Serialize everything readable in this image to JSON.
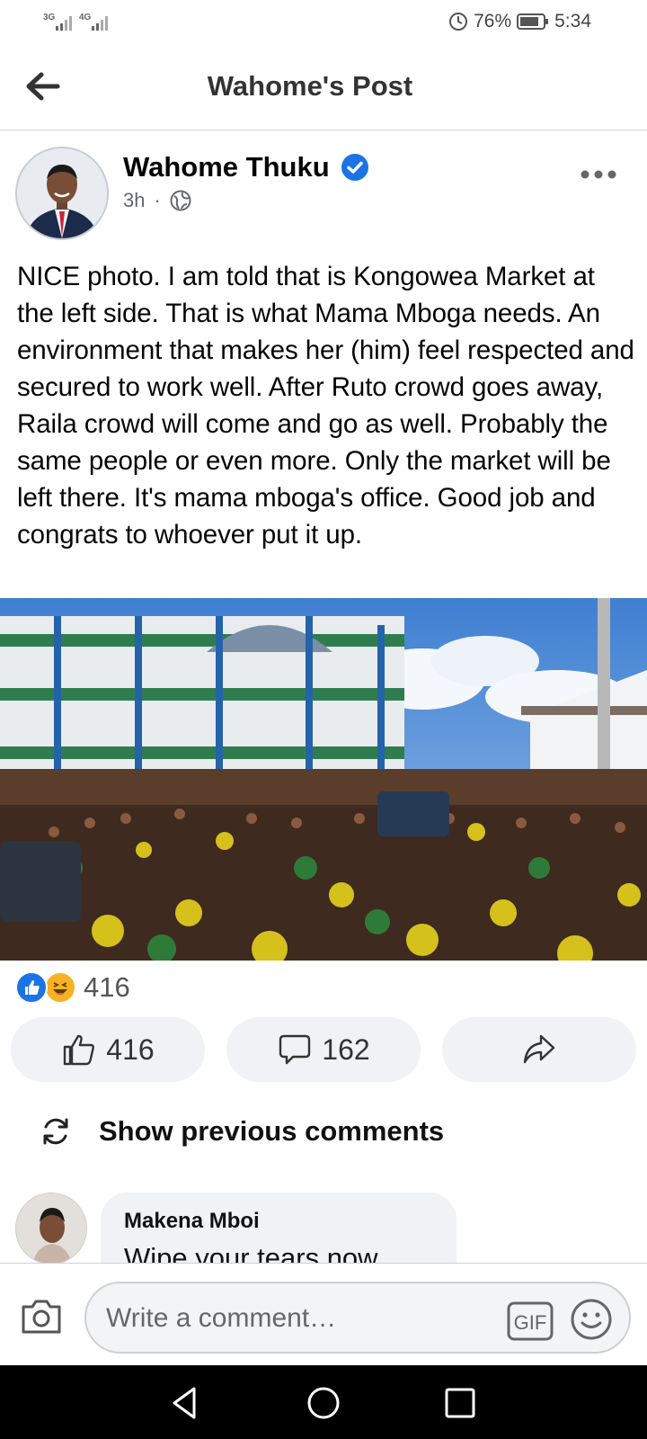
{
  "status_bar": {
    "signal_1": "3G",
    "signal_2": "4G",
    "battery": "76%",
    "time": "5:34"
  },
  "header": {
    "title": "Wahome's Post"
  },
  "post": {
    "author": "Wahome Thuku",
    "time": "3h",
    "separator": "·",
    "text": "NICE photo. I am told that is Kongowea Market at the left side. That is what Mama Mboga needs. An environment that makes her (him) feel respected and secured to work well. After Ruto crowd goes away, Raila crowd will come and go as well. Probably the same people or even more. Only the market will be left there. It's mama mboga's office. Good job and congrats to whoever put it up.",
    "reactions_count": "416",
    "reaction_icons": [
      "like-icon",
      "haha-icon"
    ]
  },
  "actions": {
    "like_count": "416",
    "comment_count": "162",
    "share_label": ""
  },
  "comments": {
    "show_previous": "Show previous comments",
    "items": [
      {
        "author": "Makena Mboi",
        "text": "Wipe your tears now..."
      }
    ]
  },
  "composer": {
    "placeholder": "Write a comment…",
    "gif_label": "GIF"
  },
  "colors": {
    "accent": "#1b74e4",
    "button_bg": "#f0f2f5",
    "meta_text": "#65676b"
  }
}
